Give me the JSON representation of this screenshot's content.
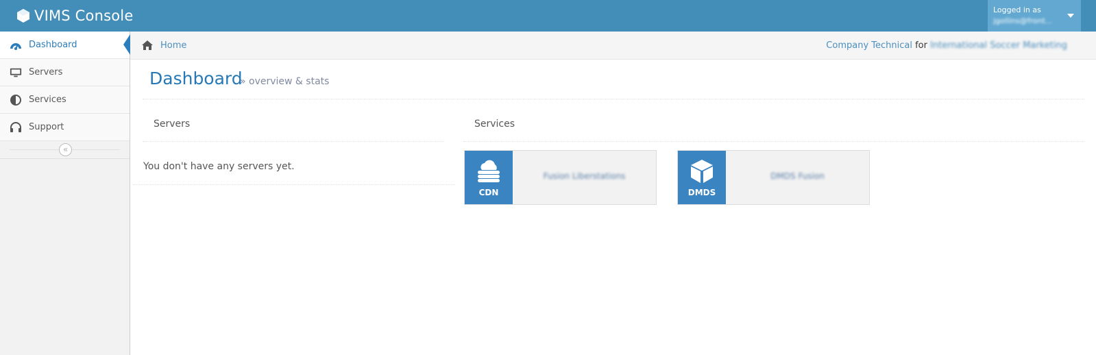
{
  "app": {
    "title": "VIMS Console",
    "brand_color": "#438eb9"
  },
  "user": {
    "logged_in_label": "Logged in as",
    "username": "jgollins@front..."
  },
  "sidebar": {
    "items": [
      {
        "label": "Dashboard",
        "icon": "dashboard-icon",
        "active": true
      },
      {
        "label": "Servers",
        "icon": "monitor-icon",
        "active": false
      },
      {
        "label": "Services",
        "icon": "adjust-icon",
        "active": false
      },
      {
        "label": "Support",
        "icon": "headset-icon",
        "active": false
      }
    ],
    "collapse_icon": "double-chevron-left-icon"
  },
  "breadcrumb": {
    "home_label": "Home",
    "company": "Company Technical",
    "for_label": "for",
    "organization": "International Soccer Marketing"
  },
  "page": {
    "title": "Dashboard",
    "subtitle": "» overview & stats"
  },
  "servers_widget": {
    "title": "Servers",
    "empty_text": "You don't have any servers yet."
  },
  "services_widget": {
    "title": "Services",
    "tiles": [
      {
        "badge": "CDN",
        "icon": "cloud-server-icon",
        "name": "Fusion Liberstations"
      },
      {
        "badge": "DMDS",
        "icon": "cube-icon",
        "name": "DMDS Fusion"
      }
    ],
    "accent_color": "#3b84c2"
  }
}
